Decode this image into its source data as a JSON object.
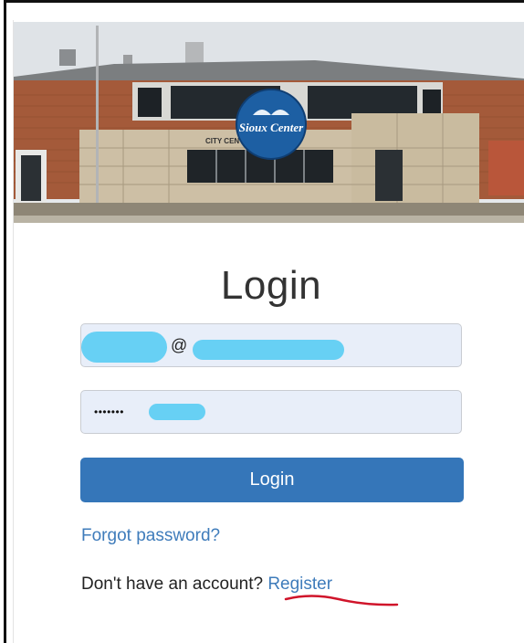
{
  "hero": {
    "logo_text": "Sioux Center",
    "logo_subtext": "",
    "building_sign": "CITY CENTER"
  },
  "login": {
    "title": "Login",
    "email_value": "@",
    "password_value": "•••••••",
    "button_label": "Login",
    "forgot_link": "Forgot password?",
    "no_account_text": "Don't have an account?",
    "register_link": "Register"
  },
  "colors": {
    "primary_button": "#3576b9",
    "link": "#3f7cbb",
    "input_bg": "#e8eef9",
    "redaction": "#67d0f4",
    "annotation": "#d0142a"
  }
}
